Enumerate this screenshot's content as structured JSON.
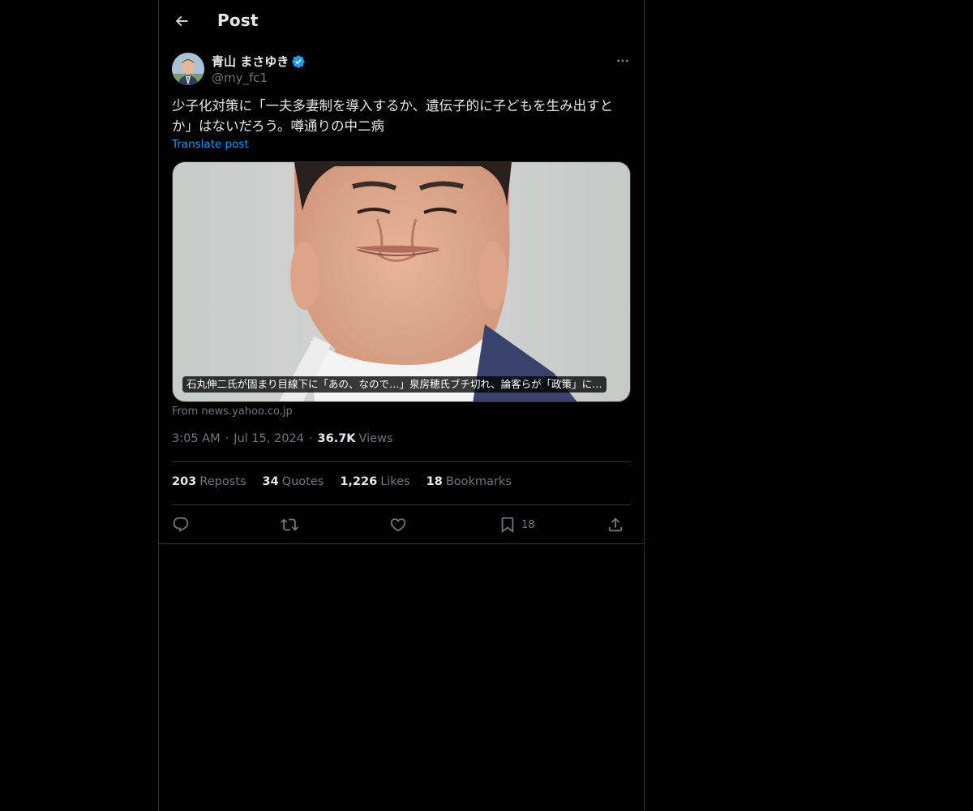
{
  "header": {
    "title": "Post"
  },
  "author": {
    "display_name": "青山 まさゆき",
    "handle": "@my_fc1",
    "verified": true
  },
  "post": {
    "text": "少子化対策に「一夫多妻制を導入するか、遺伝子的に子どもを生み出すとか」はないだろう。噂通りの中二病",
    "translate_label": "Translate post"
  },
  "card": {
    "caption": "石丸伸二氏が固まり目線下に「あの、なので…」泉房穂氏ブチ切れ、論客らが「政策」に…",
    "source": "From news.yahoo.co.jp"
  },
  "meta": {
    "time": "3:05 AM",
    "date": "Jul 15, 2024",
    "views_count": "36.7K",
    "views_label": "Views"
  },
  "stats": {
    "reposts_count": "203",
    "reposts_label": "Reposts",
    "quotes_count": "34",
    "quotes_label": "Quotes",
    "likes_count": "1,226",
    "likes_label": "Likes",
    "bookmarks_count": "18",
    "bookmarks_label": "Bookmarks"
  },
  "actions": {
    "bookmark_count": "18"
  },
  "colors": {
    "background": "#000000",
    "text_primary": "#e7e9ea",
    "text_secondary": "#71767b",
    "accent": "#1d9bf0",
    "border": "#2f3336"
  },
  "icons": {
    "back": "arrow-left-icon",
    "verified": "verified-badge-icon",
    "more": "more-horizontal-icon",
    "reply": "reply-icon",
    "repost": "repost-icon",
    "like": "heart-icon",
    "bookmark": "bookmark-icon",
    "share": "share-icon"
  }
}
